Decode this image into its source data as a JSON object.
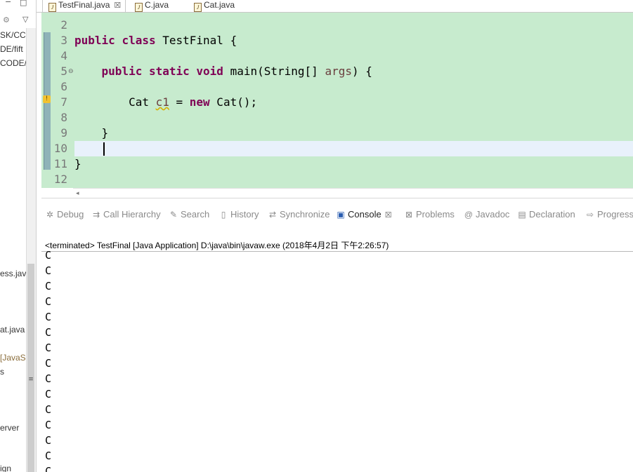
{
  "left_panel": {
    "minimize": "−",
    "maximize": "□",
    "menu": "▽",
    "fragments": [
      "SK/CC",
      "DE/fift",
      "CODE/",
      "ess.jav",
      "at.java",
      "[JavaS",
      "s",
      "erver",
      "ign"
    ]
  },
  "editor_tabs": [
    {
      "label": "TestFinal.java",
      "close": "☒"
    },
    {
      "label": "C.java"
    },
    {
      "label": "Cat.java"
    }
  ],
  "code": {
    "line_numbers": [
      "2",
      "3",
      "4",
      "5",
      "6",
      "7",
      "8",
      "9",
      "10",
      "11",
      "12"
    ],
    "lines": [
      {
        "n": "2",
        "text": ""
      },
      {
        "n": "3",
        "parts": [
          {
            "t": "public",
            "k": "kw"
          },
          {
            "t": " "
          },
          {
            "t": "class",
            "k": "kw"
          },
          {
            "t": " TestFinal {"
          }
        ]
      },
      {
        "n": "4",
        "text": ""
      },
      {
        "n": "5",
        "parts": [
          {
            "t": "    "
          },
          {
            "t": "public",
            "k": "kw"
          },
          {
            "t": " "
          },
          {
            "t": "static",
            "k": "kw"
          },
          {
            "t": " "
          },
          {
            "t": "void",
            "k": "kw"
          },
          {
            "t": " main(String[] "
          },
          {
            "t": "args",
            "k": "param"
          },
          {
            "t": ") {"
          }
        ]
      },
      {
        "n": "6",
        "text": ""
      },
      {
        "n": "7",
        "parts": [
          {
            "t": "        Cat "
          },
          {
            "t": "c1",
            "k": "warnvar"
          },
          {
            "t": " = "
          },
          {
            "t": "new",
            "k": "kw"
          },
          {
            "t": " Cat();"
          }
        ]
      },
      {
        "n": "8",
        "text": ""
      },
      {
        "n": "9",
        "parts": [
          {
            "t": "    }"
          }
        ]
      },
      {
        "n": "10",
        "text": ""
      },
      {
        "n": "11",
        "parts": [
          {
            "t": "}"
          }
        ]
      },
      {
        "n": "12",
        "text": ""
      }
    ]
  },
  "view_tabs": [
    {
      "label": "Debug",
      "icon": "✲"
    },
    {
      "label": "Call Hierarchy",
      "icon": "⇉"
    },
    {
      "label": "Search",
      "icon": "✎"
    },
    {
      "label": "History",
      "icon": "▯"
    },
    {
      "label": "Synchronize",
      "icon": "⇄"
    },
    {
      "label": "Console",
      "icon": "▣",
      "close": "☒"
    },
    {
      "label": "Problems",
      "icon": "⊠"
    },
    {
      "label": "Javadoc",
      "icon": "@"
    },
    {
      "label": "Declaration",
      "icon": "▤"
    },
    {
      "label": "Progress",
      "icon": "⇨"
    }
  ],
  "console": {
    "header": "<terminated> TestFinal [Java Application] D:\\java\\bin\\javaw.exe (2018年4月2日 下午2:26:57)",
    "lines": [
      "C",
      "C",
      "C",
      "C",
      "C",
      "C",
      "C",
      "C",
      "C",
      "C",
      "C",
      "C",
      "C",
      "C",
      "C",
      "C"
    ]
  },
  "colors": {
    "editor_bg": "#c7ebce",
    "current_line": "#e8f1fb",
    "keyword": "#7f0055",
    "local_var": "#6a3e3e"
  }
}
